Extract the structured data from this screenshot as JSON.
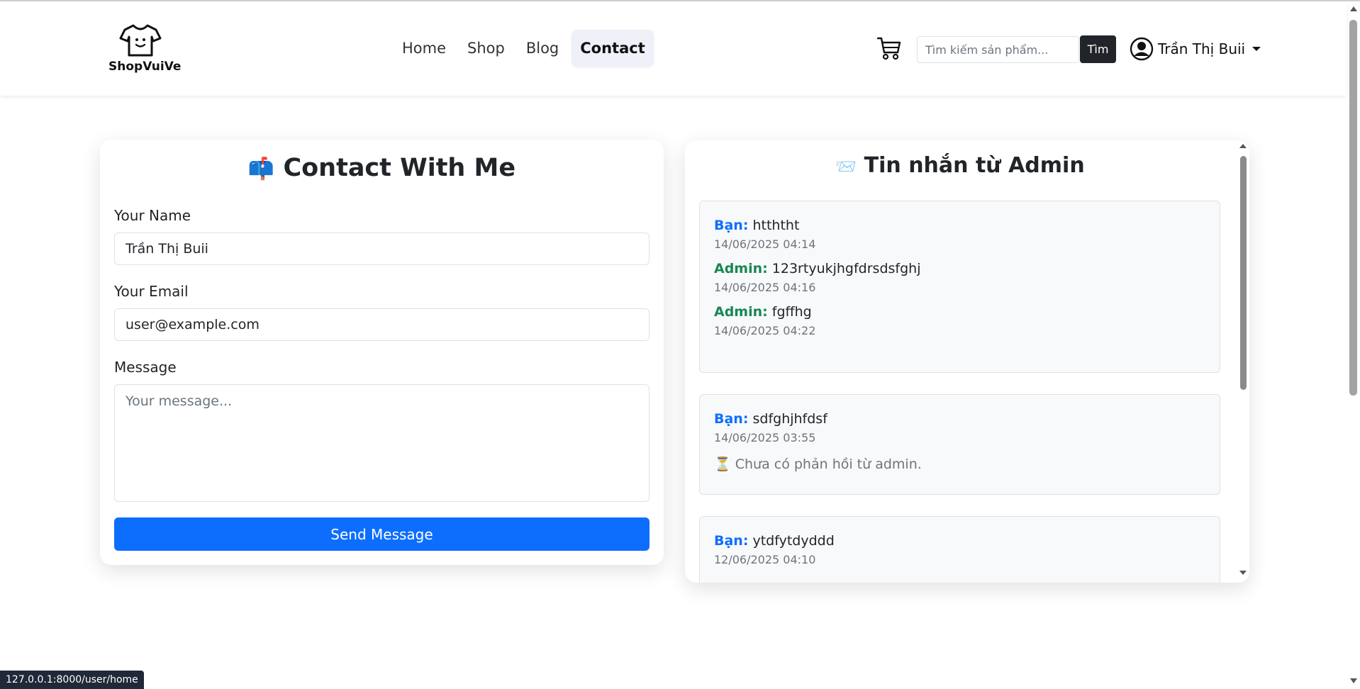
{
  "header": {
    "brand": "ShopVuiVe",
    "nav": [
      {
        "label": "Home",
        "active": false
      },
      {
        "label": "Shop",
        "active": false
      },
      {
        "label": "Blog",
        "active": false
      },
      {
        "label": "Contact",
        "active": true
      }
    ],
    "search_placeholder": "Tìm kiếm sản phẩm...",
    "search_button": "Tìm",
    "user_name": "Trần Thị Buii"
  },
  "contact_form": {
    "title": "Contact With Me",
    "title_icon": "📫",
    "name_label": "Your Name",
    "name_value": "Trần Thị Buii",
    "email_label": "Your Email",
    "email_value": "user@example.com",
    "message_label": "Message",
    "message_placeholder": "Your message...",
    "send_button": "Send Message"
  },
  "messages": {
    "title": "Tin nhắn từ Admin",
    "title_icon": "📨",
    "threads": [
      {
        "entries": [
          {
            "who": "Bạn:",
            "text": "htththt",
            "time": "14/06/2025 04:14"
          },
          {
            "who": "Admin:",
            "text": "123rtyukjhgfdrsdsfghj",
            "time": "14/06/2025 04:16"
          },
          {
            "who": "Admin:",
            "text": "fgffhg",
            "time": "14/06/2025 04:22"
          }
        ]
      },
      {
        "entries": [
          {
            "who": "Bạn:",
            "text": "sdfghjhfdsf",
            "time": "14/06/2025 03:55"
          }
        ],
        "pending_icon": "⏳",
        "pending": "Chưa có phản hồi từ admin."
      },
      {
        "entries": [
          {
            "who": "Bạn:",
            "text": "ytdfytdyddd",
            "time": "12/06/2025 04:10"
          }
        ]
      }
    ]
  },
  "status_bar": "127.0.0.1:8000/user/home",
  "colors": {
    "primary": "#0d6efd",
    "admin": "#198754",
    "dark": "#212529"
  }
}
